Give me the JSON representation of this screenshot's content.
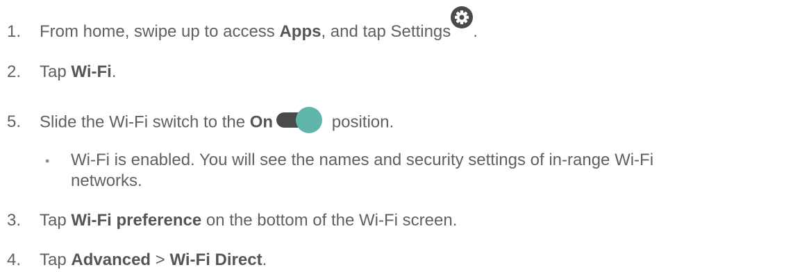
{
  "steps": [
    {
      "number": "1.",
      "text_before": "From home, swipe up to access ",
      "bold": "Apps",
      "text_after": ", and tap Settings",
      "icon": "settings-gear-icon",
      "tail": "."
    },
    {
      "number": "2.",
      "text_before": "Tap ",
      "bold": "Wi-Fi",
      "text_after": "."
    },
    {
      "number": "5.",
      "text_before": "Slide the Wi-Fi switch to the ",
      "bold": "On",
      "icon": "toggle-switch-on-icon",
      "text_after": " position."
    },
    {
      "number": "3.",
      "text_before": "Tap ",
      "bold": "Wi-Fi preference",
      "text_after": " on the bottom of the Wi-Fi screen."
    },
    {
      "number": "4.",
      "text_before": "Tap ",
      "bold": "Advanced",
      "middle": " > ",
      "bold2": "Wi-Fi Direct",
      "text_after": "."
    }
  ],
  "bullet": {
    "symbol": "•",
    "line1": "Wi-Fi is enabled. You will see the names and security settings of in-range Wi-Fi",
    "line2": "networks."
  },
  "colors": {
    "text": "#606060",
    "gear_bg": "#4a4a4a",
    "toggle_track": "#4a4a4a",
    "toggle_thumb": "#5fb5a9"
  }
}
